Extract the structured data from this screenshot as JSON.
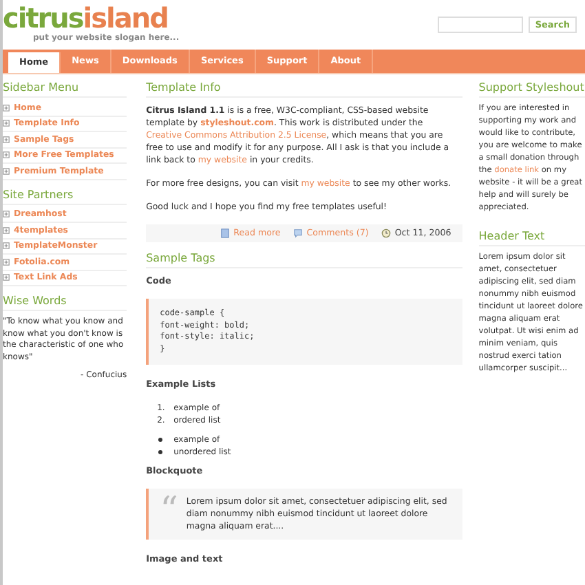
{
  "header": {
    "logo_left": "citrus",
    "logo_right": "island",
    "slogan": "put your website slogan here...",
    "search": {
      "button": "Search"
    }
  },
  "nav": [
    {
      "label": "Home",
      "selected": true
    },
    {
      "label": "News",
      "selected": false
    },
    {
      "label": "Downloads",
      "selected": false
    },
    {
      "label": "Services",
      "selected": false
    },
    {
      "label": "Support",
      "selected": false
    },
    {
      "label": "About",
      "selected": false
    }
  ],
  "left": {
    "sections": [
      {
        "title": "Sidebar Menu",
        "items": [
          "Home",
          "Template Info",
          "Sample Tags",
          "More Free Templates",
          "Premium Template"
        ]
      },
      {
        "title": "Site Partners",
        "items": [
          "Dreamhost",
          "4templates",
          "TemplateMonster",
          "Fotolia.com",
          "Text Link Ads"
        ]
      }
    ],
    "wise_words": {
      "title": "Wise Words",
      "quote": "\"To know what you know and know what you don't know is the characteristic of one who knows\"",
      "author": "- Confucius"
    }
  },
  "main": {
    "title": "Template Info",
    "paragraphs": [
      [
        {
          "kind": "bold",
          "text": "Citrus Island 1.1"
        },
        {
          "kind": "plain",
          "text": " is is a free, W3C-compliant, CSS-based website template by "
        },
        {
          "kind": "boldlink",
          "text": "styleshout.com"
        },
        {
          "kind": "plain",
          "text": ". This work is distributed under the "
        },
        {
          "kind": "link",
          "text": "Creative Commons Attribution 2.5 License"
        },
        {
          "kind": "plain",
          "text": ", which means that you are free to use and modify it for any purpose. All I ask is that you include a link back to "
        },
        {
          "kind": "link",
          "text": "my website"
        },
        {
          "kind": "plain",
          "text": " in your credits."
        }
      ],
      [
        {
          "kind": "plain",
          "text": "For more free designs, you can visit "
        },
        {
          "kind": "link",
          "text": "my website"
        },
        {
          "kind": "plain",
          "text": " to see my other works."
        }
      ],
      [
        {
          "kind": "plain",
          "text": "Good luck and I hope you find my free templates useful!"
        }
      ]
    ],
    "meta": {
      "read_more": "Read more",
      "comments": "Comments (7)",
      "date": "Oct 11, 2006"
    },
    "sample_title": "Sample Tags",
    "code_heading": "Code",
    "code_lines": [
      "code-sample {",
      "font-weight: bold;",
      "font-style: italic;",
      "}"
    ],
    "lists_heading": "Example Lists",
    "ordered": [
      {
        "number": "1.",
        "text": "example of"
      },
      {
        "number": "2.",
        "text": "ordered list"
      }
    ],
    "unordered": [
      "example of",
      "unordered list"
    ],
    "quote_heading": "Blockquote",
    "quote_mark": "“",
    "quote": "Lorem ipsum dolor sit amet, consectetuer adipiscing elit, sed diam nonummy nibh euismod tincidunt ut laoreet dolore magna aliquam erat....",
    "image_heading": "Image and text"
  },
  "right": {
    "support_title": "Support Styleshout",
    "support": [
      {
        "kind": "plain",
        "text": "If you are interested in supporting my work and would like to contribute, you are welcome to make a small donation through the "
      },
      {
        "kind": "link",
        "text": "donate link"
      },
      {
        "kind": "plain",
        "text": " on my website - it will be a great help and will surely be appreciated."
      }
    ],
    "header_title": "Header Text",
    "header_text": "Lorem ipsum dolor sit amet, consectetuer adipiscing elit, sed diam nonummy nibh euismod tincidunt ut laoreet dolore magna aliquam erat volutpat. Ut wisi enim ad minim veniam, quis nostrud exerci tation ullamcorper suscipit..."
  }
}
